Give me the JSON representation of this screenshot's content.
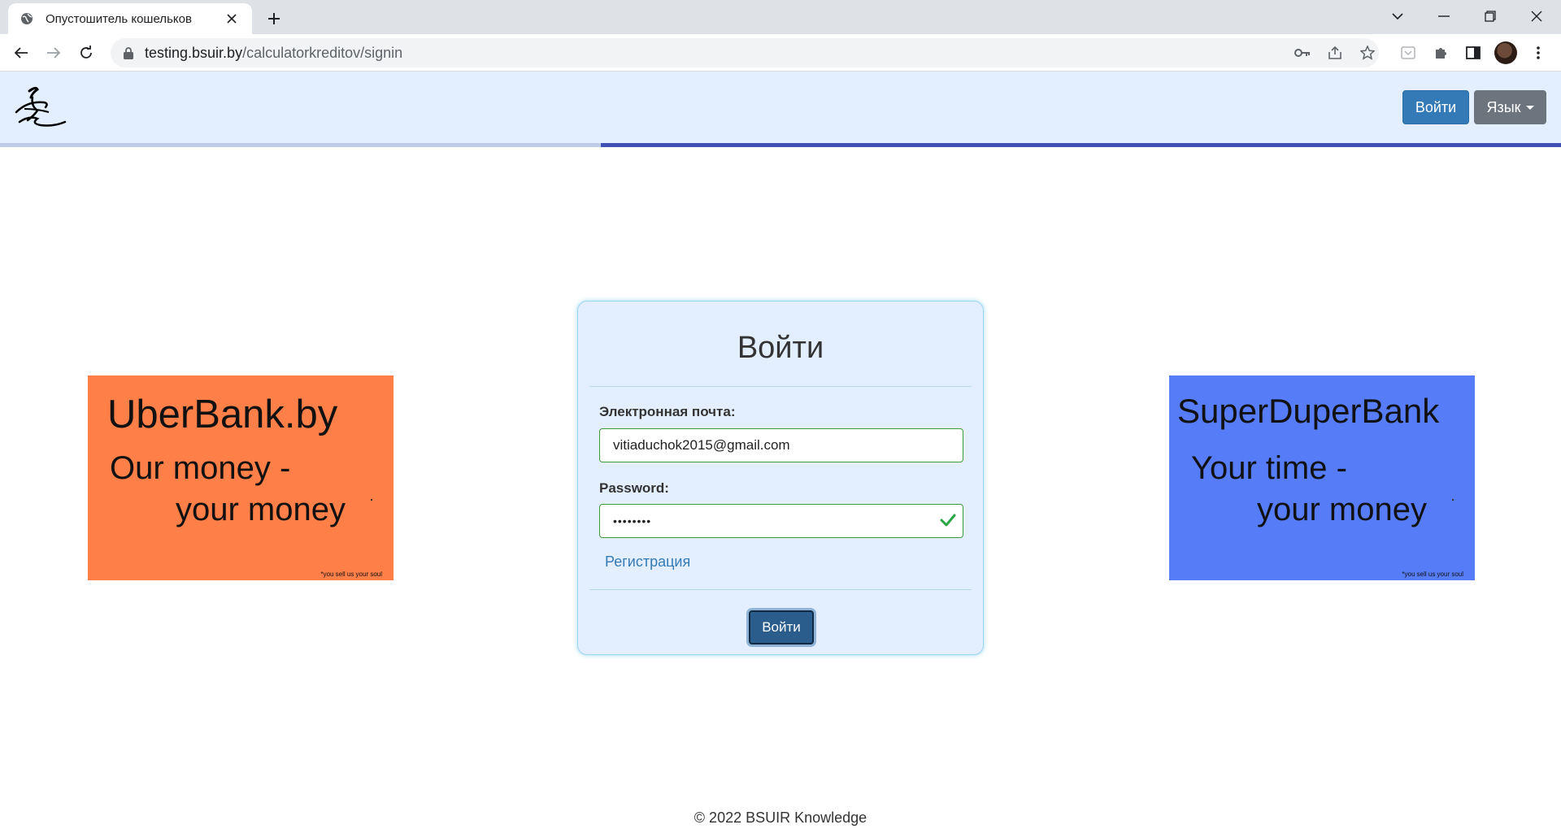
{
  "browser": {
    "tab_title": "Опустошитель кошельков",
    "url_host": "testing.bsuir.by",
    "url_path": "/calculatorkreditov/signin"
  },
  "header": {
    "login_button": "Войти",
    "language_button": "Язык"
  },
  "page_load_progress": 0.615,
  "ads": {
    "left": {
      "title": "UberBank.by",
      "line1": "Our money -",
      "line2": "your money",
      "fineprint": "*you sell us your soul",
      "color": "#ff7f48"
    },
    "right": {
      "title": "SuperDuperBank",
      "line1": "Your time -",
      "line2": "your money",
      "fineprint": "*you sell us your soul",
      "color": "#567cf8"
    }
  },
  "login_form": {
    "title": "Войти",
    "email_label": "Электронная почта:",
    "email_value": "vitiaduchok2015@gmail.com",
    "password_label": "Password:",
    "password_value": "••••••••",
    "register_link": "Регистрация",
    "submit_button": "Войти"
  },
  "footer": {
    "copyright": "© 2022 BSUIR Knowledge"
  },
  "colors": {
    "header_bg": "#e3efff",
    "primary": "#337ab7",
    "secondary": "#6c757d",
    "valid_green": "#28a745"
  }
}
